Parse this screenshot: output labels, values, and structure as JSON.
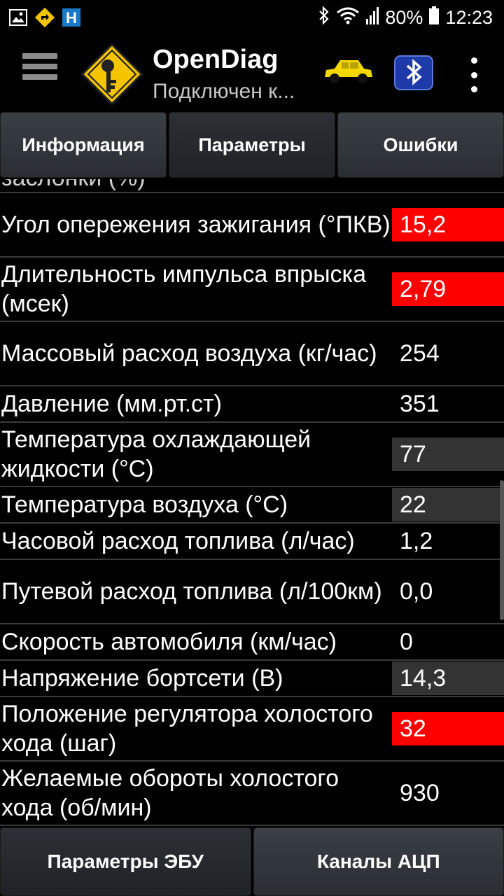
{
  "status_bar": {
    "battery": "80%",
    "time": "12:23",
    "icons": [
      "gallery-icon",
      "nav-warning-icon",
      "hotel-h-icon",
      "bluetooth-icon",
      "wifi-icon",
      "signal-icon",
      "battery-icon"
    ],
    "hotel_letter": "H"
  },
  "app_bar": {
    "title": "OpenDiag",
    "subtitle": "Подключен к...",
    "car_color": "#f4d800",
    "bt_color": "#1e3aa8"
  },
  "tabs": [
    {
      "label": "Информация",
      "active": false
    },
    {
      "label": "Параметры",
      "active": true
    },
    {
      "label": "Ошибки",
      "active": false
    }
  ],
  "params": {
    "clipped_label": "заслонки (%)",
    "rows": [
      {
        "label": "Угол опережения зажигания (°ПКВ)",
        "value": "15,2",
        "highlight": "red"
      },
      {
        "label": "Длительность импульса впрыска (мсек)",
        "value": "2,79",
        "highlight": "red"
      },
      {
        "label": "Массовый расход воздуха (кг/час)",
        "value": "254",
        "highlight": "none"
      },
      {
        "label": "Давление (мм.рт.ст)",
        "value": "351",
        "highlight": "none"
      },
      {
        "label": "Температура охлаждающей жидкости (°C)",
        "value": "77",
        "highlight": "gray"
      },
      {
        "label": "Температура воздуха (°C)",
        "value": "22",
        "highlight": "gray"
      },
      {
        "label": "Часовой расход топлива (л/час)",
        "value": "1,2",
        "highlight": "none"
      },
      {
        "label": "Путевой расход топлива (л/100км)",
        "value": "0,0",
        "highlight": "none"
      },
      {
        "label": "Скорость автомобиля (км/час)",
        "value": "0",
        "highlight": "none"
      },
      {
        "label": "Напряжение бортсети (В)",
        "value": "14,3",
        "highlight": "gray"
      },
      {
        "label": "Положение регулятора холостого хода (шаг)",
        "value": "32",
        "highlight": "red"
      },
      {
        "label": "Желаемые обороты холостого хода (об/мин)",
        "value": "930",
        "highlight": "none"
      }
    ]
  },
  "bottom_tabs": [
    {
      "label": "Параметры ЭБУ",
      "active": true
    },
    {
      "label": "Каналы АЦП",
      "active": false
    }
  ]
}
